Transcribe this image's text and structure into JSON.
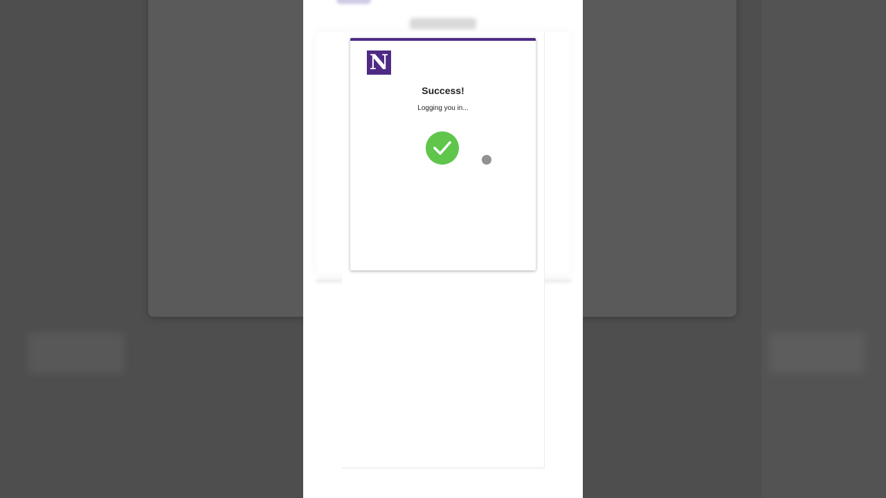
{
  "modal": {
    "logo_letter": "N",
    "title": "Success!",
    "subtitle": "Logging you in...",
    "accent_color": "#4e2a84",
    "success_color": "#5fc64b"
  },
  "icons": {
    "logo": "northwestern-n-logo",
    "status": "checkmark-icon",
    "pointer": "cursor-dot"
  }
}
